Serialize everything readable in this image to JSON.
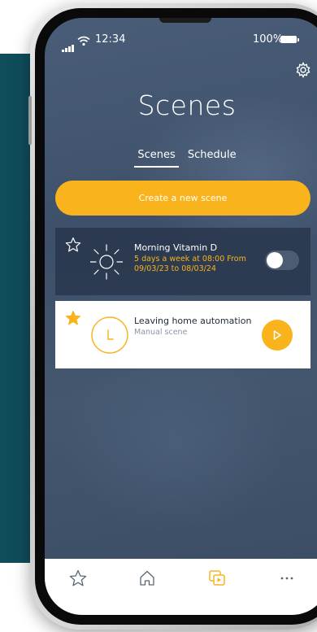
{
  "status_bar": {
    "time": "12:34",
    "battery_percent": "100%"
  },
  "header": {
    "title": "Scenes"
  },
  "tabs": [
    {
      "label": "Scenes",
      "active": true
    },
    {
      "label": "Schedule",
      "active": false
    }
  ],
  "create_button": {
    "label": "Create a new scene"
  },
  "scenes": [
    {
      "name": "Morning Vitamin D",
      "subtitle": "5 days a week at 08:00 From 09/03/23 to 08/03/24",
      "favorite": false,
      "icon": "sun-icon",
      "control": "toggle",
      "enabled": false
    },
    {
      "name": "Leaving home automation",
      "subtitle": "Manual scene",
      "favorite": true,
      "icon": "clock-icon",
      "control": "play-button"
    }
  ],
  "bottom_nav": {
    "items": [
      {
        "icon": "star-icon",
        "active": false
      },
      {
        "icon": "home-icon",
        "active": false
      },
      {
        "icon": "scenes-icon",
        "active": true
      },
      {
        "icon": "more-icon",
        "active": false
      }
    ]
  },
  "colors": {
    "accent": "#f8b31d",
    "background_teal": "#0f4d5b",
    "screen_bg": "#44576f",
    "card_dark": "#243246",
    "card_light": "#ffffff"
  }
}
